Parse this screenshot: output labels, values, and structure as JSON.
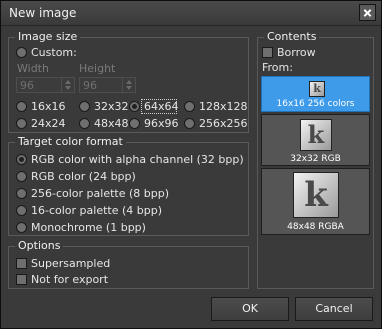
{
  "window": {
    "title": "New image"
  },
  "image_size": {
    "title": "Image size",
    "custom_label": "Custom:",
    "width_label": "Width",
    "height_label": "Height",
    "width_value": "96",
    "height_value": "96",
    "sizes": [
      "16x16",
      "32x32",
      "64x64",
      "128x128",
      "24x24",
      "48x48",
      "96x96",
      "256x256"
    ],
    "selected": "64x64"
  },
  "color_format": {
    "title": "Target color format",
    "options": [
      "RGB color with alpha channel (32 bpp)",
      "RGB color (24 bpp)",
      "256-color palette (8 bpp)",
      "16-color palette (4 bpp)",
      "Monochrome (1 bpp)"
    ],
    "selected_index": 0
  },
  "options": {
    "title": "Options",
    "supersampled": "Supersampled",
    "not_for_export": "Not for export"
  },
  "contents": {
    "title": "Contents",
    "borrow": "Borrow",
    "from": "From:",
    "previews": [
      {
        "label": "16x16 256 colors",
        "selected": true,
        "glyph": "k"
      },
      {
        "label": "32x32 RGB",
        "selected": false,
        "glyph": "k"
      },
      {
        "label": "48x48 RGBA",
        "selected": false,
        "glyph": "k"
      }
    ]
  },
  "buttons": {
    "ok": "OK",
    "cancel": "Cancel"
  },
  "colors": {
    "accent": "#3e9be9",
    "background": "#3a3a3a"
  }
}
